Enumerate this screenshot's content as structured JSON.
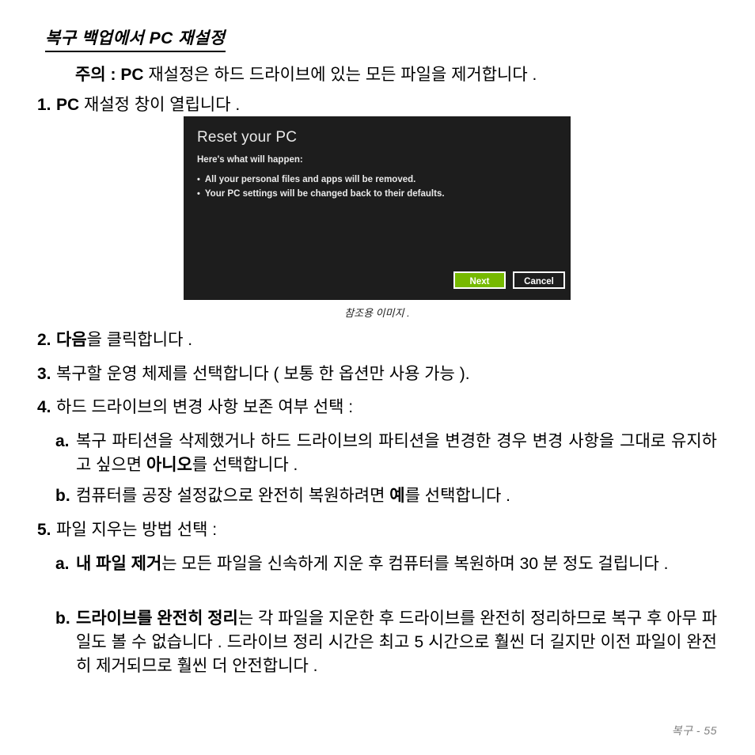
{
  "heading": "복구 백업에서 PC 재설정",
  "note": {
    "label": "주의 :",
    "bold_term": "PC",
    "text_rest": " 재설정은 하드 드라이브에 있는 모든 파일을 제거합니다 ."
  },
  "steps": [
    {
      "marker": "1.",
      "bold_lead": "PC",
      "text": " 재설정 창이 열립니다 ."
    },
    {
      "marker": "2.",
      "bold_lead": "다음",
      "text": "을 클릭합니다 ."
    },
    {
      "marker": "3.",
      "bold_lead": "",
      "text": "복구할 운영 체제를 선택합니다 ( 보통 한 옵션만 사용 가능 )."
    },
    {
      "marker": "4.",
      "bold_lead": "",
      "text": "하드 드라이브의 변경 사항 보존 여부 선택 :"
    },
    {
      "marker": "5.",
      "bold_lead": "",
      "text": "파일 지우는 방법 선택 :"
    }
  ],
  "substeps_4": [
    {
      "marker": "a.",
      "pre": "복구 파티션을 삭제했거나 하드 드라이브의 파티션을 변경한 경우 변경 사항을 그대로 유지하고 싶으면 ",
      "bold": "아니오",
      "post": "를 선택합니다 ."
    },
    {
      "marker": "b.",
      "pre": "컴퓨터를 공장 설정값으로 완전히 복원하려면 ",
      "bold": "예",
      "post": "를 선택합니다 ."
    }
  ],
  "substeps_5": [
    {
      "marker": "a.",
      "pre": "",
      "bold": "내 파일 제거",
      "post": "는 모든 파일을 신속하게 지운 후 컴퓨터를 복원하며 30 분 정도 걸립니다 ."
    },
    {
      "marker": "b.",
      "pre": "",
      "bold": "드라이브를 완전히 정리",
      "post": "는 각 파일을 지운한 후 드라이브를 완전히 정리하므로 복구 후 아무 파일도 볼 수 없습니다 . 드라이브 정리 시간은 최고 5 시간으로 훨씬 더 길지만 이전 파일이 완전히 제거되므로 훨씬 더 안전합니다 ."
    }
  ],
  "figure": {
    "dialog": {
      "title": "Reset your PC",
      "subtitle": "Here's what will happen:",
      "bullets": [
        "All your personal files and apps will be removed.",
        "Your PC settings will be changed back to their defaults."
      ],
      "next_label": "Next",
      "cancel_label": "Cancel",
      "next_color": "#76b900",
      "background_color": "#1d1d1d"
    },
    "caption": "참조용 이미지 ."
  },
  "footer": "복구 - 55"
}
